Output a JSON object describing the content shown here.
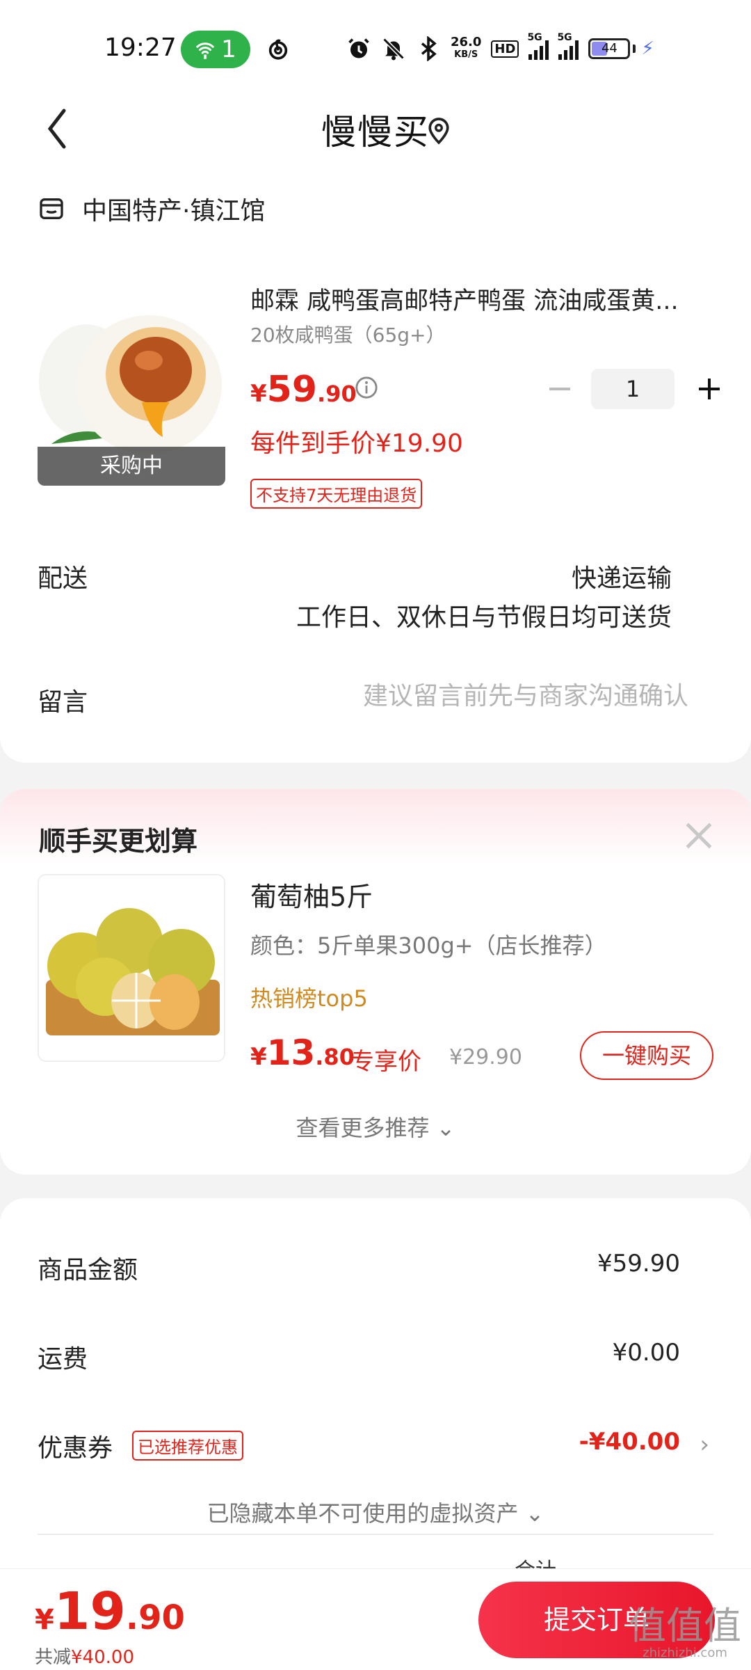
{
  "status_bar": {
    "time": "19:27",
    "hotspot_count": "1",
    "net_speed_value": "26.0",
    "net_speed_unit": "KB/S",
    "hd": "HD",
    "sim1": "5G",
    "sim2": "5G",
    "battery_level": "44",
    "battery_fill_fraction": 0.44
  },
  "header": {
    "title": "慢慢买"
  },
  "order_card": {
    "shop_name": "中国特产·镇江馆",
    "product": {
      "title": "邮霖 咸鸭蛋高邮特产鸭蛋 流油咸蛋黄...",
      "spec": "20枚咸鸭蛋（65g+）",
      "image_tag": "采购中",
      "price_currency": "¥",
      "price_int": "59",
      "price_dec": ".90",
      "quantity": "1",
      "unit_price": "每件到手价¥19.90",
      "no_return_badge": "不支持7天无理由退货"
    },
    "shipping": {
      "label": "配送",
      "method": "快递运输",
      "desc": "工作日、双休日与节假日均可送货"
    },
    "message": {
      "label": "留言",
      "placeholder": "建议留言前先与商家沟通确认"
    }
  },
  "recommend_card": {
    "title": "顺手买更划算",
    "item": {
      "name": "葡萄柚5斤",
      "spec": "颜色：5斤单果300g+（店长推荐）",
      "hot": "热销榜top5",
      "price_currency": "¥",
      "price_int": "13",
      "price_dec": ".80",
      "exclusive": "专享价",
      "original_price": "¥29.90",
      "buy_label": "一键购买"
    },
    "more_label": "查看更多推荐 ⌄"
  },
  "summary_card": {
    "goods_label": "商品金额",
    "goods_value": "¥59.90",
    "shipping_label": "运费",
    "shipping_value": "¥0.00",
    "coupon_label": "优惠券",
    "coupon_badge": "已选推荐优惠",
    "coupon_value": "-¥40.00",
    "hidden_assets": "已隐藏本单不可使用的虚拟资产 ⌄",
    "partial_text": "合计"
  },
  "bottom_bar": {
    "total_currency": "¥",
    "total_int": "19",
    "total_dec": ".90",
    "saved_label": "共减",
    "saved_amount": "¥40.00",
    "submit_label": "提交订单"
  },
  "watermark": {
    "logo": "值值值",
    "text": "zhizhizhi.com"
  },
  "colors": {
    "accent_red": "#e2231a",
    "hotspot_green": "#2fb24a",
    "hot_orange": "#d08a20",
    "page_bg": "#f3f3f3"
  }
}
